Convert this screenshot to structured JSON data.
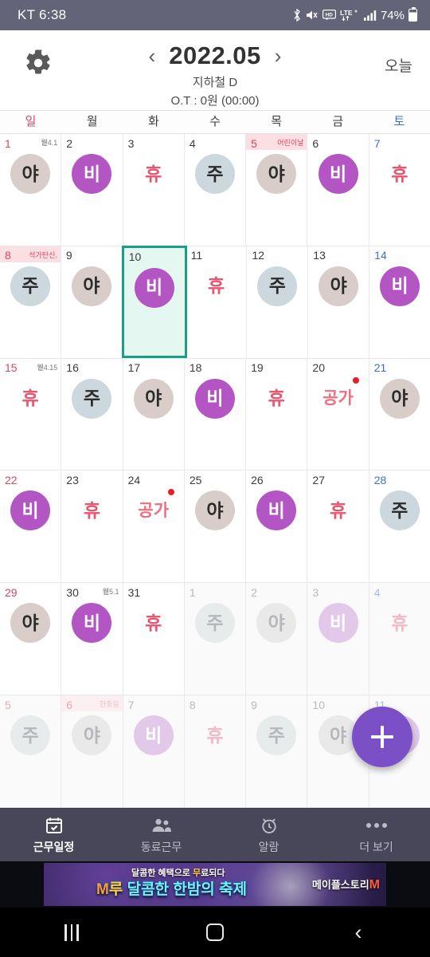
{
  "statusbar": {
    "carrier_time": "KT 6:38",
    "battery_pct": "74%",
    "icons": [
      "bluetooth-icon",
      "mute-icon",
      "hd-icon",
      "lte-plus-icon",
      "signal-icon",
      "battery-icon"
    ]
  },
  "header": {
    "settings_icon": "gear-icon",
    "prev_label": "‹",
    "month_title": "2022.05",
    "next_label": "›",
    "subtitle_team": "지하철 D",
    "subtitle_ot": "O.T : 0원 (00:00)",
    "today_label": "오늘"
  },
  "weekdays": [
    {
      "label": "일",
      "kind": "sun"
    },
    {
      "label": "월",
      "kind": "wd"
    },
    {
      "label": "화",
      "kind": "wd"
    },
    {
      "label": "수",
      "kind": "wd"
    },
    {
      "label": "목",
      "kind": "wd"
    },
    {
      "label": "금",
      "kind": "wd"
    },
    {
      "label": "토",
      "kind": "sat"
    }
  ],
  "shift_types": {
    "ya": {
      "label": "야",
      "color": "#d8cdc8",
      "text": "#2b2b2b"
    },
    "bi": {
      "label": "비",
      "color": "#b356c4",
      "text": "#ffffff"
    },
    "ju": {
      "label": "주",
      "color": "#ccd8dd",
      "text": "#2b2b2b"
    },
    "hyu": {
      "label": "휴",
      "color": "transparent",
      "text": "#e8566f"
    },
    "gong": {
      "label": "공가",
      "color": "transparent",
      "text": "#ef6f80"
    }
  },
  "selection": {
    "selected_day": "10",
    "border_color": "#17a086",
    "fill_color": "#e4f7f0"
  },
  "weeks": [
    [
      {
        "day": "1",
        "type": "ya",
        "kind": "sun",
        "sub": "윁4.1",
        "sub_kind": "lunar",
        "out": false,
        "dot": false,
        "selected": false
      },
      {
        "day": "2",
        "type": "bi",
        "kind": "wd",
        "sub": "",
        "sub_kind": "",
        "out": false,
        "dot": false,
        "selected": false
      },
      {
        "day": "3",
        "type": "hyu",
        "kind": "wd",
        "sub": "",
        "sub_kind": "",
        "out": false,
        "dot": false,
        "selected": false
      },
      {
        "day": "4",
        "type": "ju",
        "kind": "wd",
        "sub": "",
        "sub_kind": "",
        "out": false,
        "dot": false,
        "selected": false
      },
      {
        "day": "5",
        "type": "ya",
        "kind": "sun",
        "sub": "어린이날",
        "sub_kind": "holiday",
        "out": false,
        "dot": false,
        "selected": false
      },
      {
        "day": "6",
        "type": "bi",
        "kind": "wd",
        "sub": "",
        "sub_kind": "",
        "out": false,
        "dot": false,
        "selected": false
      },
      {
        "day": "7",
        "type": "hyu",
        "kind": "sat",
        "sub": "",
        "sub_kind": "",
        "out": false,
        "dot": false,
        "selected": false
      }
    ],
    [
      {
        "day": "8",
        "type": "ju",
        "kind": "sun",
        "sub": "석가탄신.",
        "sub_kind": "holiday",
        "out": false,
        "dot": false,
        "selected": false
      },
      {
        "day": "9",
        "type": "ya",
        "kind": "wd",
        "sub": "",
        "sub_kind": "",
        "out": false,
        "dot": false,
        "selected": false
      },
      {
        "day": "10",
        "type": "bi",
        "kind": "wd",
        "sub": "",
        "sub_kind": "",
        "out": false,
        "dot": false,
        "selected": true
      },
      {
        "day": "11",
        "type": "hyu",
        "kind": "wd",
        "sub": "",
        "sub_kind": "",
        "out": false,
        "dot": false,
        "selected": false
      },
      {
        "day": "12",
        "type": "ju",
        "kind": "wd",
        "sub": "",
        "sub_kind": "",
        "out": false,
        "dot": false,
        "selected": false
      },
      {
        "day": "13",
        "type": "ya",
        "kind": "wd",
        "sub": "",
        "sub_kind": "",
        "out": false,
        "dot": false,
        "selected": false
      },
      {
        "day": "14",
        "type": "bi",
        "kind": "sat",
        "sub": "",
        "sub_kind": "",
        "out": false,
        "dot": false,
        "selected": false
      }
    ],
    [
      {
        "day": "15",
        "type": "hyu",
        "kind": "sun",
        "sub": "윁4.15",
        "sub_kind": "lunar",
        "out": false,
        "dot": false,
        "selected": false
      },
      {
        "day": "16",
        "type": "ju",
        "kind": "wd",
        "sub": "",
        "sub_kind": "",
        "out": false,
        "dot": false,
        "selected": false
      },
      {
        "day": "17",
        "type": "ya",
        "kind": "wd",
        "sub": "",
        "sub_kind": "",
        "out": false,
        "dot": false,
        "selected": false
      },
      {
        "day": "18",
        "type": "bi",
        "kind": "wd",
        "sub": "",
        "sub_kind": "",
        "out": false,
        "dot": false,
        "selected": false
      },
      {
        "day": "19",
        "type": "hyu",
        "kind": "wd",
        "sub": "",
        "sub_kind": "",
        "out": false,
        "dot": false,
        "selected": false
      },
      {
        "day": "20",
        "type": "gong",
        "kind": "wd",
        "sub": "",
        "sub_kind": "",
        "out": false,
        "dot": true,
        "selected": false
      },
      {
        "day": "21",
        "type": "ya",
        "kind": "sat",
        "sub": "",
        "sub_kind": "",
        "out": false,
        "dot": false,
        "selected": false
      }
    ],
    [
      {
        "day": "22",
        "type": "bi",
        "kind": "sun",
        "sub": "",
        "sub_kind": "",
        "out": false,
        "dot": false,
        "selected": false
      },
      {
        "day": "23",
        "type": "hyu",
        "kind": "wd",
        "sub": "",
        "sub_kind": "",
        "out": false,
        "dot": false,
        "selected": false
      },
      {
        "day": "24",
        "type": "gong",
        "kind": "wd",
        "sub": "",
        "sub_kind": "",
        "out": false,
        "dot": true,
        "selected": false
      },
      {
        "day": "25",
        "type": "ya",
        "kind": "wd",
        "sub": "",
        "sub_kind": "",
        "out": false,
        "dot": false,
        "selected": false
      },
      {
        "day": "26",
        "type": "bi",
        "kind": "wd",
        "sub": "",
        "sub_kind": "",
        "out": false,
        "dot": false,
        "selected": false
      },
      {
        "day": "27",
        "type": "hyu",
        "kind": "wd",
        "sub": "",
        "sub_kind": "",
        "out": false,
        "dot": false,
        "selected": false
      },
      {
        "day": "28",
        "type": "ju",
        "kind": "sat",
        "sub": "",
        "sub_kind": "",
        "out": false,
        "dot": false,
        "selected": false
      }
    ],
    [
      {
        "day": "29",
        "type": "ya",
        "kind": "sun",
        "sub": "",
        "sub_kind": "",
        "out": false,
        "dot": false,
        "selected": false
      },
      {
        "day": "30",
        "type": "bi",
        "kind": "wd",
        "sub": "윁5.1",
        "sub_kind": "lunar",
        "out": false,
        "dot": false,
        "selected": false
      },
      {
        "day": "31",
        "type": "hyu",
        "kind": "wd",
        "sub": "",
        "sub_kind": "",
        "out": false,
        "dot": false,
        "selected": false
      },
      {
        "day": "1",
        "type": "ju",
        "kind": "wd",
        "sub": "",
        "sub_kind": "",
        "out": true,
        "dot": false,
        "selected": false
      },
      {
        "day": "2",
        "type": "ya",
        "kind": "wd",
        "sub": "",
        "sub_kind": "",
        "out": true,
        "dot": false,
        "selected": false
      },
      {
        "day": "3",
        "type": "bi",
        "kind": "wd",
        "sub": "",
        "sub_kind": "",
        "out": true,
        "dot": false,
        "selected": false
      },
      {
        "day": "4",
        "type": "hyu",
        "kind": "sat",
        "sub": "",
        "sub_kind": "",
        "out": true,
        "dot": false,
        "selected": false
      }
    ],
    [
      {
        "day": "5",
        "type": "ju",
        "kind": "sun",
        "sub": "",
        "sub_kind": "",
        "out": true,
        "dot": false,
        "selected": false
      },
      {
        "day": "6",
        "type": "ya",
        "kind": "sun",
        "sub": "현충일",
        "sub_kind": "holiday",
        "out": true,
        "dot": false,
        "selected": false
      },
      {
        "day": "7",
        "type": "bi",
        "kind": "wd",
        "sub": "",
        "sub_kind": "",
        "out": true,
        "dot": false,
        "selected": false
      },
      {
        "day": "8",
        "type": "hyu",
        "kind": "wd",
        "sub": "",
        "sub_kind": "",
        "out": true,
        "dot": false,
        "selected": false
      },
      {
        "day": "9",
        "type": "ju",
        "kind": "wd",
        "sub": "",
        "sub_kind": "",
        "out": true,
        "dot": false,
        "selected": false
      },
      {
        "day": "10",
        "type": "ya",
        "kind": "wd",
        "sub": "",
        "sub_kind": "",
        "out": true,
        "dot": false,
        "selected": false
      },
      {
        "day": "11",
        "type": "bi",
        "kind": "sat",
        "sub": "",
        "sub_kind": "",
        "out": true,
        "dot": false,
        "selected": false
      }
    ]
  ],
  "fab": {
    "icon": "plus-icon",
    "color": "#7b4fc6"
  },
  "bottomnav": [
    {
      "label": "근무일정",
      "icon": "calendar-check-icon",
      "active": true
    },
    {
      "label": "동료근무",
      "icon": "people-icon",
      "active": false
    },
    {
      "label": "알람",
      "icon": "alarm-clock-icon",
      "active": false
    },
    {
      "label": "더 보기",
      "icon": "more-dots-icon",
      "active": false
    }
  ],
  "ad": {
    "line1_a": "달콤한 혜택으로 ",
    "line1_b": "무",
    "line1_c": "료되다",
    "line2_m": "M",
    "line2_u": "루",
    "line2_rest": " 달콤한 한밤의 축제",
    "brand": "메이플스토리",
    "brand_m": "M"
  },
  "androidnav": {
    "recents": "recents-icon",
    "home": "home-icon",
    "back": "back-icon"
  }
}
